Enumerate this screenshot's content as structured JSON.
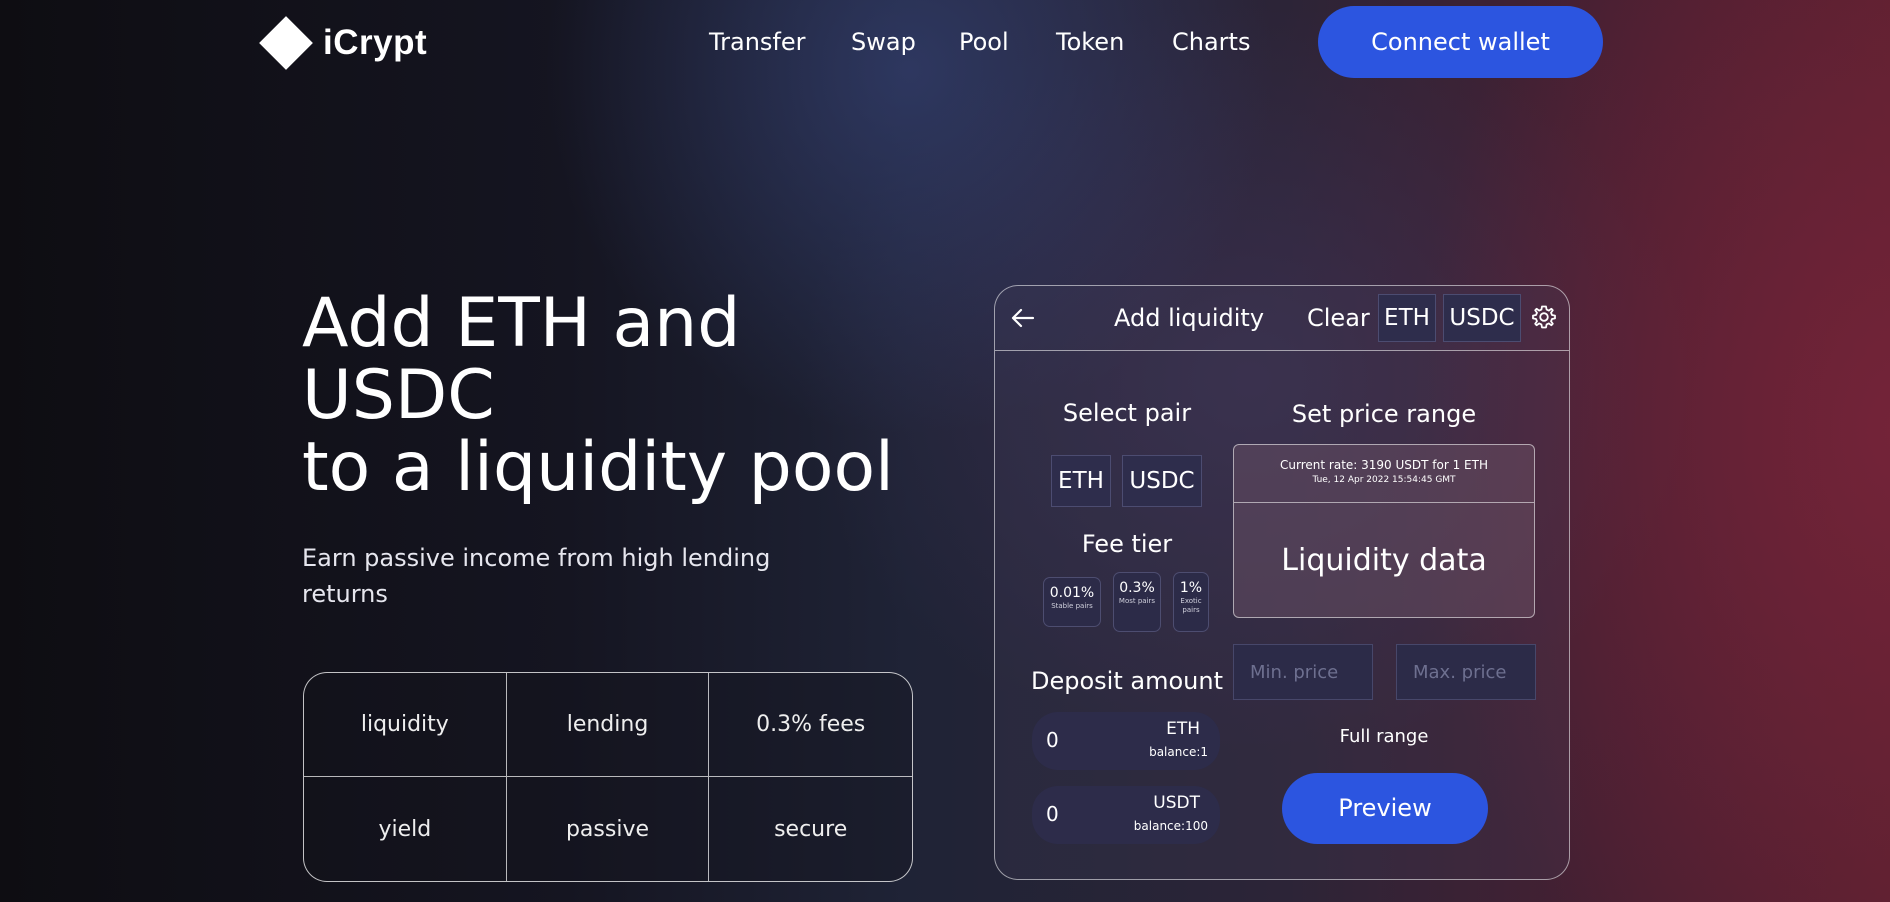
{
  "header": {
    "logo_text": "iCrypt",
    "nav": [
      "Transfer",
      "Swap",
      "Pool",
      "Token",
      "Charts"
    ],
    "connect_label": "Connect wallet"
  },
  "hero": {
    "title_lines": [
      "Add ETH and",
      "USDC",
      "to a liquidity pool"
    ],
    "subtitle": "Earn passive income from high lending returns",
    "tags": [
      "liquidity",
      "lending",
      "0.3% fees",
      "yield",
      "passive",
      "secure"
    ]
  },
  "card": {
    "title": "Add liquidity",
    "clear_label": "Clear",
    "header_tokens": [
      "ETH",
      "USDC"
    ],
    "select_pair_label": "Select pair",
    "pair_tokens": [
      "ETH",
      "USDC"
    ],
    "fee_tier_label": "Fee tier",
    "fee_tiers": [
      {
        "pct": "0.01%",
        "desc": "Stable pairs"
      },
      {
        "pct": "0.3%",
        "desc": "Most pairs"
      },
      {
        "pct": "1%",
        "desc": "Exotic pairs"
      }
    ],
    "price_range_label": "Set price range",
    "current_rate": "Current rate: 3190 USDT for 1 ETH",
    "rate_timestamp": "Tue, 12 Apr 2022 15:54:45 GMT",
    "liquidity_data_label": "Liquidity data",
    "min_price_placeholder": "Min. price",
    "max_price_placeholder": "Max. price",
    "full_range_label": "Full range",
    "deposit_label": "Deposit amount",
    "deposits": [
      {
        "value": "0",
        "token": "ETH",
        "balance": "balance:1"
      },
      {
        "value": "0",
        "token": "USDT",
        "balance": "balance:100"
      }
    ],
    "preview_label": "Preview"
  },
  "colors": {
    "accent": "#2c55e0",
    "chip_bg": "#2e2d4c"
  },
  "icons": [
    "diamond-logo",
    "back-arrow-icon",
    "gear-icon"
  ]
}
